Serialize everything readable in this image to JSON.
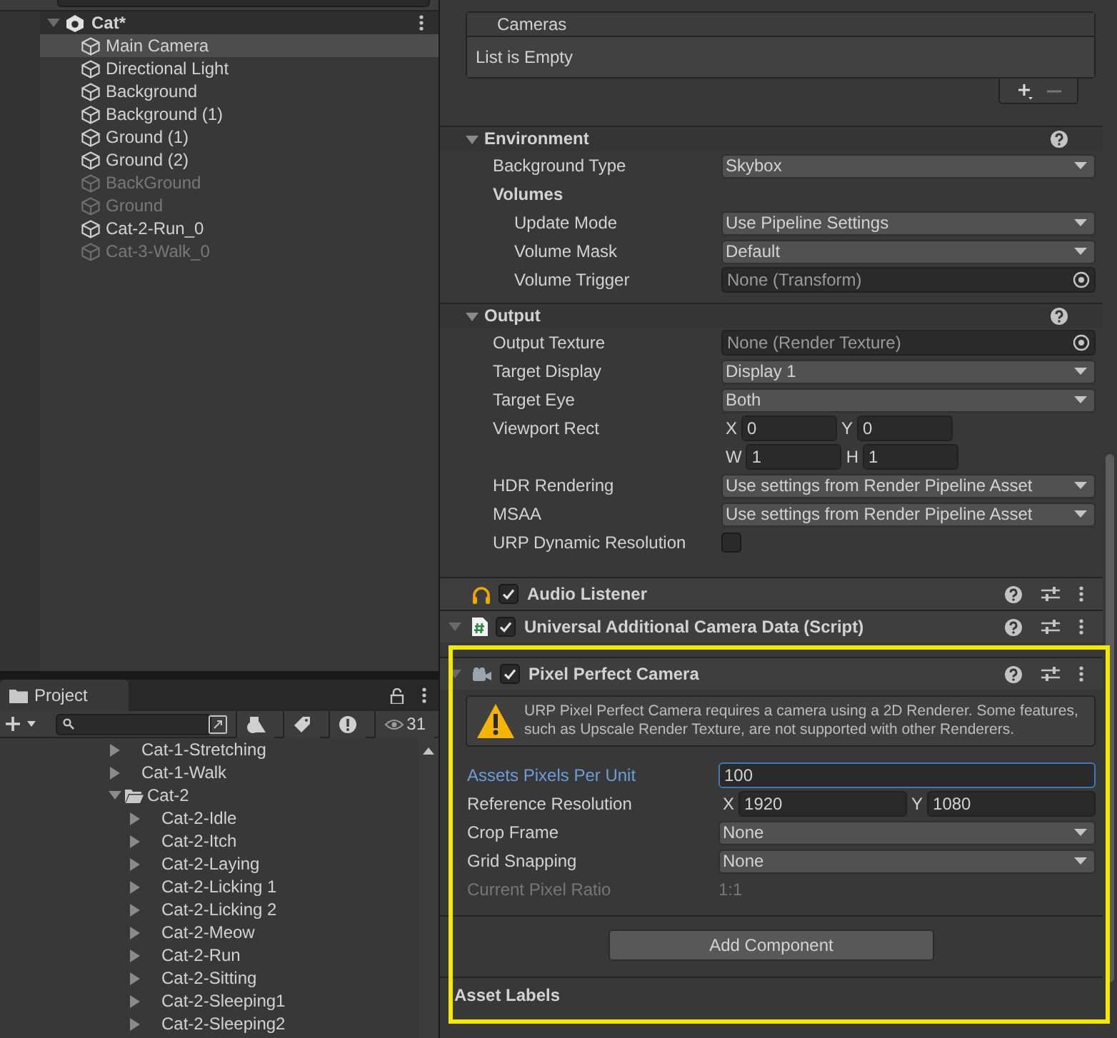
{
  "hierarchy": {
    "scene": {
      "label": "Cat*"
    },
    "items": [
      {
        "label": "Main Camera",
        "active": true,
        "selected": true
      },
      {
        "label": "Directional Light",
        "active": true,
        "selected": false
      },
      {
        "label": "Background",
        "active": true,
        "selected": false
      },
      {
        "label": "Background (1)",
        "active": true,
        "selected": false
      },
      {
        "label": "Ground (1)",
        "active": true,
        "selected": false
      },
      {
        "label": "Ground (2)",
        "active": true,
        "selected": false
      },
      {
        "label": "BackGround",
        "active": false,
        "selected": false
      },
      {
        "label": "Ground",
        "active": false,
        "selected": false
      },
      {
        "label": "Cat-2-Run_0",
        "active": true,
        "selected": false
      },
      {
        "label": "Cat-3-Walk_0",
        "active": false,
        "selected": false
      }
    ]
  },
  "project": {
    "tab": "Project",
    "visible_count": "31",
    "tree": [
      {
        "children": [
          {
            "label": "Cat-1-Stretching",
            "expanded": false
          },
          {
            "label": "Cat-1-Walk",
            "expanded": false
          }
        ]
      },
      {
        "label": "Cat-2",
        "expanded": true,
        "children": [
          {
            "label": "Cat-2-Idle",
            "expanded": false
          },
          {
            "label": "Cat-2-Itch",
            "expanded": false
          },
          {
            "label": "Cat-2-Laying",
            "expanded": false
          },
          {
            "label": "Cat-2-Licking 1",
            "expanded": false
          },
          {
            "label": "Cat-2-Licking 2",
            "expanded": false
          },
          {
            "label": "Cat-2-Meow",
            "expanded": false
          },
          {
            "label": "Cat-2-Run",
            "expanded": false
          },
          {
            "label": "Cat-2-Sitting",
            "expanded": false
          },
          {
            "label": "Cat-2-Sleeping1",
            "expanded": false
          },
          {
            "label": "Cat-2-Sleeping2",
            "expanded": false
          }
        ]
      }
    ]
  },
  "inspector": {
    "cameras": {
      "header": "Cameras",
      "empty_text": "List is Empty"
    },
    "sections": [
      {
        "title": "Environment",
        "expanded": true,
        "fields": [
          {
            "kind": "dropdown",
            "label": "Background Type",
            "value": "Skybox"
          },
          {
            "kind": "subheader",
            "label": "Volumes",
            "children": [
              {
                "kind": "dropdown",
                "label": "Update Mode",
                "value": "Use Pipeline Settings"
              },
              {
                "kind": "dropdown",
                "label": "Volume Mask",
                "value": "Default"
              },
              {
                "kind": "object",
                "label": "Volume Trigger",
                "value": "None (Transform)"
              }
            ]
          }
        ]
      },
      {
        "title": "Output",
        "expanded": true,
        "fields": [
          {
            "kind": "object",
            "label": "Output Texture",
            "value": "None (Render Texture)"
          },
          {
            "kind": "dropdown",
            "label": "Target Display",
            "value": "Display 1"
          },
          {
            "kind": "dropdown",
            "label": "Target Eye",
            "value": "Both"
          },
          {
            "kind": "vector",
            "label": "Viewport Rect",
            "components": [
              {
                "axis": "X",
                "value": "0"
              },
              {
                "axis": "Y",
                "value": "0"
              },
              {
                "axis": "W",
                "value": "1"
              },
              {
                "axis": "H",
                "value": "1"
              }
            ]
          },
          {
            "kind": "dropdown",
            "label": "HDR Rendering",
            "value": "Use settings from Render Pipeline Asset"
          },
          {
            "kind": "dropdown",
            "label": "MSAA",
            "value": "Use settings from Render Pipeline Asset"
          },
          {
            "kind": "toggle",
            "label": "URP Dynamic Resolution",
            "checked": false
          }
        ]
      }
    ],
    "components": [
      {
        "kind": "audio",
        "title": "Audio Listener",
        "enabled": true,
        "foldout": false,
        "highlighted": false
      },
      {
        "kind": "script",
        "title": "Universal Additional Camera Data (Script)",
        "enabled": true,
        "foldout": true,
        "highlighted": false
      },
      {
        "kind": "camera",
        "title": "Pixel Perfect Camera",
        "enabled": true,
        "foldout": true,
        "highlighted": true,
        "warning": "URP Pixel Perfect Camera requires a camera using a 2D Renderer. Some features, such as Upscale Render Texture, are not supported with other Renderers.",
        "fields": [
          {
            "kind": "int",
            "label": "Assets Pixels Per Unit",
            "value": "100",
            "focused": true
          },
          {
            "kind": "vector",
            "label": "Reference Resolution",
            "components": [
              {
                "axis": "X",
                "value": "1920"
              },
              {
                "axis": "Y",
                "value": "1080"
              }
            ]
          },
          {
            "kind": "dropdown",
            "label": "Crop Frame",
            "value": "None"
          },
          {
            "kind": "dropdown",
            "label": "Grid Snapping",
            "value": "None"
          },
          {
            "kind": "readonly",
            "label": "Current Pixel Ratio",
            "value": "1:1",
            "disabled": true
          }
        ]
      }
    ],
    "add_component": "Add Component",
    "asset_labels": "Asset Labels"
  }
}
